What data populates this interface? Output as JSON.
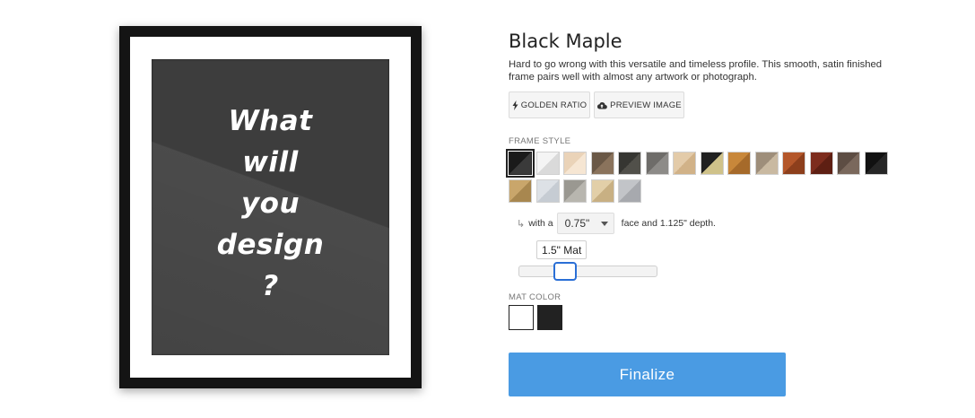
{
  "preview": {
    "art_lines": [
      "What",
      "will",
      "you",
      "design",
      "?"
    ]
  },
  "product": {
    "title": "Black Maple",
    "description": "Hard to go wrong with this versatile and timeless profile. This smooth, satin finished frame pairs well with almost any artwork or photograph."
  },
  "buttons": {
    "golden_ratio": "GOLDEN RATIO",
    "preview_image": "PREVIEW IMAGE",
    "golden_ratio_icon": "bolt-icon",
    "preview_image_icon": "cloud-upload-icon"
  },
  "frame_style": {
    "label": "FRAME STYLE",
    "selected_index": 0,
    "swatches": [
      {
        "colors": [
          "#1a1a1a",
          "#3a3a3a"
        ]
      },
      {
        "colors": [
          "#f4f4f4",
          "#dadada"
        ]
      },
      {
        "colors": [
          "#ead3b8",
          "#f6e6d3"
        ]
      },
      {
        "colors": [
          "#6a5846",
          "#8a735c"
        ]
      },
      {
        "colors": [
          "#363632",
          "#51504a"
        ]
      },
      {
        "colors": [
          "#6e6c69",
          "#8d8b88"
        ]
      },
      {
        "colors": [
          "#e3cba9",
          "#d1b288"
        ]
      },
      {
        "colors": [
          "#202020",
          "#cfc28a"
        ]
      },
      {
        "colors": [
          "#c8873a",
          "#a66a2a"
        ]
      },
      {
        "colors": [
          "#9e8e7a",
          "#c9b9a1"
        ]
      },
      {
        "colors": [
          "#b4572a",
          "#8d3f1c"
        ]
      },
      {
        "colors": [
          "#7d2c1d",
          "#5e1f13"
        ]
      },
      {
        "colors": [
          "#5d4d43",
          "#7a685c"
        ]
      },
      {
        "colors": [
          "#111111",
          "#262626"
        ]
      },
      {
        "colors": [
          "#c9a66b",
          "#a8874f"
        ]
      },
      {
        "colors": [
          "#dde1e6",
          "#c6ccd3"
        ]
      },
      {
        "colors": [
          "#9a9891",
          "#b8b6af"
        ]
      },
      {
        "colors": [
          "#e2cfa8",
          "#c8b083"
        ]
      },
      {
        "colors": [
          "#c2c4c8",
          "#a7a9ae"
        ]
      }
    ]
  },
  "face": {
    "prefix": "with a",
    "value": "0.75\"",
    "suffix": "face and 1.125\" depth."
  },
  "mat": {
    "size_label": "1.5\" Mat",
    "level": 0.3
  },
  "mat_color": {
    "label": "MAT COLOR",
    "options": [
      "#ffffff",
      "#222222"
    ],
    "selected_index": 0
  },
  "cta": {
    "finalize": "Finalize"
  },
  "colors": {
    "accent": "#4a9be3",
    "slider_focus": "#2a6fd6"
  }
}
